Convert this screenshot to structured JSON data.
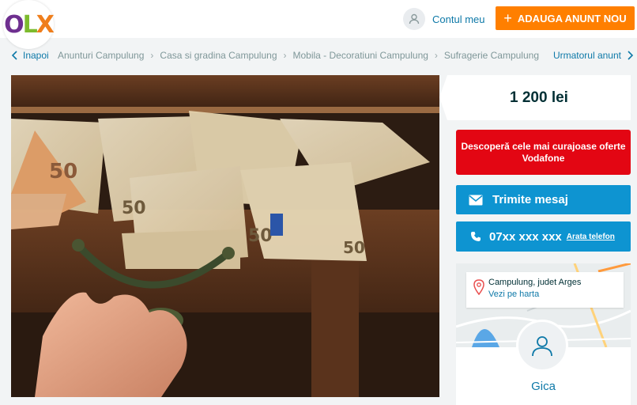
{
  "header": {
    "logo": "OLX",
    "account_label": "Contul meu",
    "post_ad_label": "ADAUGA ANUNT NOU",
    "post_ad_plus": "+"
  },
  "breadcrumb": {
    "back_label": "Inapoi",
    "items": [
      "Anunturi Campulung",
      "Casa si gradina Campulung",
      "Mobila - Decoratiuni Campulung",
      "Sufragerie Campulung"
    ],
    "next_label": "Urmatorul anunt"
  },
  "listing": {
    "price": "1 200 lei",
    "promo": "Descoperă cele mai curajoase oferte Vodafone",
    "message_label": "Trimite mesaj",
    "phone_masked": "07xx xxx xxx",
    "phone_reveal": "Arata telefon",
    "location": "Campulung, judet Arges",
    "map_link": "Vezi pe harta",
    "seller_name": "Gica"
  },
  "colors": {
    "accent_orange": "#ff7f00",
    "action_blue": "#0e94d1",
    "promo_red": "#e30613",
    "link_blue": "#0e79a8"
  }
}
